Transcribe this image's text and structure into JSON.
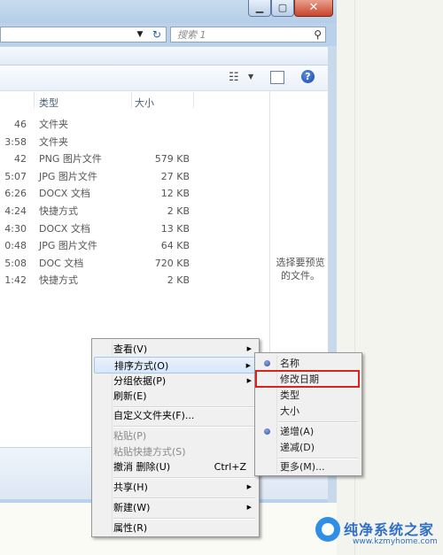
{
  "search": {
    "placeholder": "搜索 1"
  },
  "columns": {
    "type": "类型",
    "size": "大小"
  },
  "files": [
    {
      "time": "46",
      "type": "文件夹",
      "size": ""
    },
    {
      "time": "3:58",
      "type": "文件夹",
      "size": ""
    },
    {
      "time": "42",
      "type": "PNG 图片文件",
      "size": "579 KB"
    },
    {
      "time": "5:07",
      "type": "JPG 图片文件",
      "size": "27 KB"
    },
    {
      "time": "6:26",
      "type": "DOCX 文档",
      "size": "12 KB"
    },
    {
      "time": "4:24",
      "type": "快捷方式",
      "size": "2 KB"
    },
    {
      "time": "4:30",
      "type": "DOCX 文档",
      "size": "13 KB"
    },
    {
      "time": "0:48",
      "type": "JPG 图片文件",
      "size": "64 KB"
    },
    {
      "time": "5:08",
      "type": "DOC 文档",
      "size": "720 KB"
    },
    {
      "time": "1:42",
      "type": "快捷方式",
      "size": "2 KB"
    }
  ],
  "preview_pane": {
    "text": "选择要预览的文件。"
  },
  "context_menu": {
    "view": "查看(V)",
    "sort": "排序方式(O)",
    "group": "分组依据(P)",
    "refresh": "刷新(E)",
    "customize": "自定义文件夹(F)...",
    "paste": "粘贴(P)",
    "paste_shortcut": "粘贴快捷方式(S)",
    "undo": "撤消 删除(U)",
    "undo_shortcut": "Ctrl+Z",
    "share": "共享(H)",
    "new": "新建(W)",
    "properties": "属性(R)"
  },
  "sort_menu": {
    "name": "名称",
    "modified": "修改日期",
    "type": "类型",
    "size": "大小",
    "ascending": "递增(A)",
    "descending": "递减(D)",
    "more": "更多(M)..."
  },
  "watermark": {
    "title": "纯净系统之家",
    "url": "www.kzmyhome.com"
  },
  "colors": {
    "highlight_box": "#d9231d",
    "menu_bg": "#f0f0f0"
  }
}
